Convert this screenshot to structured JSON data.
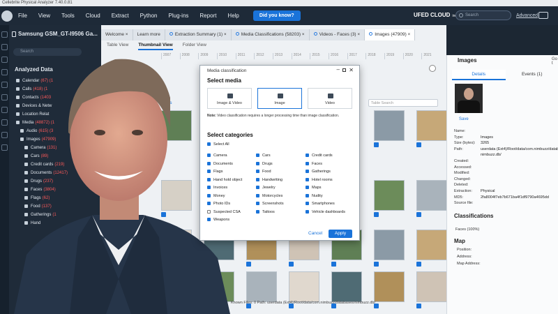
{
  "window": {
    "title": "Cellebrite Physical Analyzer 7.40.0.81"
  },
  "menubar": {
    "items": [
      "File",
      "View",
      "Tools",
      "Cloud",
      "Extract",
      "Python",
      "Plug-ins",
      "Report",
      "Help"
    ],
    "did_you_know": "Did you know?",
    "ufed_cloud": "UFED CLOUD",
    "ufed_cloud_sub": "included",
    "search_placeholder": "Search",
    "advanced": "Advanced"
  },
  "left_panel": {
    "device": "Samsung GSM_GT-I9506 Ga...",
    "search_placeholder": "Search",
    "analyzed_data": "Analyzed Data",
    "tree": [
      {
        "label": "Calendar",
        "count": "(67)",
        "extra": " (1"
      },
      {
        "label": "Calls",
        "count": "(418)",
        "extra": " (1"
      },
      {
        "label": "Contacts",
        "count": "(1403",
        "extra": ""
      },
      {
        "label": "Devices & Netw",
        "count": "",
        "extra": ""
      },
      {
        "label": "Location Relat",
        "count": "",
        "extra": ""
      },
      {
        "label": "Media",
        "count": "(48872)",
        "extra": " (1"
      },
      {
        "label": "Audio",
        "count": "(615)",
        "extra": " (3"
      },
      {
        "label": "Images",
        "count": "(47909)",
        "extra": ""
      },
      {
        "label": "Camera",
        "count": "(131)",
        "extra": ""
      },
      {
        "label": "Cars",
        "count": "(89)",
        "extra": ""
      },
      {
        "label": "Credit cards",
        "count": "(219)",
        "extra": ""
      },
      {
        "label": "Documents",
        "count": "(12417)",
        "extra": ""
      },
      {
        "label": "Drugs",
        "count": "(237)",
        "extra": ""
      },
      {
        "label": "Faces",
        "count": "(3804)",
        "extra": ""
      },
      {
        "label": "Flags",
        "count": "(62)",
        "extra": ""
      },
      {
        "label": "Food",
        "count": "(137)",
        "extra": ""
      },
      {
        "label": "Gatherings",
        "count": "(1",
        "extra": ""
      },
      {
        "label": "Hand",
        "count": "",
        "extra": ""
      }
    ]
  },
  "tabs": [
    {
      "label": "Welcome",
      "closable": true
    },
    {
      "label": "Learn more",
      "closable": false
    },
    {
      "label": "Extraction Summary (1)",
      "closable": true
    },
    {
      "label": "Media Classifications (58203)",
      "closable": true
    },
    {
      "label": "Videos - Faces (3)",
      "closable": true
    },
    {
      "label": "Images (47909)",
      "closable": true,
      "active": true
    }
  ],
  "sub_tabs": [
    "Table View",
    "Thumbnail View",
    "Folder View"
  ],
  "timeline": [
    "2007",
    "2008",
    "2009",
    "2010",
    "2011",
    "2012",
    "2013",
    "2014",
    "2015",
    "2016",
    "2017",
    "2018",
    "2019",
    "2020",
    "2021"
  ],
  "filters_label": "filters",
  "table_search_placeholder": "Table Search",
  "status": "Known Files: 0     Path: userdata (Ext4)/Root/data/com.nimbuzz/databases/nimbuzz.db/",
  "right_panel": {
    "title": "Images",
    "goto": "Go t",
    "tabs": [
      "Details",
      "Events (1)"
    ],
    "save": "Save",
    "fields": [
      {
        "k": "Name:",
        "v": ""
      },
      {
        "k": "Type:",
        "v": "Images"
      },
      {
        "k": "Size (bytes):",
        "v": "3265"
      },
      {
        "k": "Path:",
        "v": "userdata (Ext4)/Root/data/com.nimbuzz/databa"
      },
      {
        "k": "",
        "v": "nimbuzz.db/"
      },
      {
        "k": "Created:",
        "v": ""
      },
      {
        "k": "Accessed:",
        "v": ""
      },
      {
        "k": "Modified:",
        "v": ""
      },
      {
        "k": "Changed:",
        "v": ""
      },
      {
        "k": "Deleted:",
        "v": ""
      },
      {
        "k": "Extraction:",
        "v": "Physical"
      },
      {
        "k": "MD5:",
        "v": "2fa8004f7eb7b671ba4f1df9790a4695dd"
      },
      {
        "k": "Source file:",
        "v": ""
      }
    ],
    "classifications_title": "Classifications",
    "classifications_value": "Faces (100%)",
    "map_title": "Map",
    "map_fields": [
      "Position:",
      "Address:",
      "Map Address:"
    ]
  },
  "dialog": {
    "title": "Media classification",
    "select_media": "Select media",
    "media_options": [
      "Image & Video",
      "Image",
      "Video"
    ],
    "selected_media": "Image",
    "note_bold": "Note:",
    "note": " Video classification requires a longer processing time than image classification.",
    "select_categories": "Select categories",
    "select_all": "Select All",
    "categories": [
      {
        "label": "Camera",
        "checked": true
      },
      {
        "label": "Cars",
        "checked": true
      },
      {
        "label": "Credit cards",
        "checked": true
      },
      {
        "label": "Documents",
        "checked": true
      },
      {
        "label": "Drugs",
        "checked": true
      },
      {
        "label": "Faces",
        "checked": true
      },
      {
        "label": "Flags",
        "checked": true
      },
      {
        "label": "Food",
        "checked": true
      },
      {
        "label": "Gatherings",
        "checked": true
      },
      {
        "label": "Hand hold object",
        "checked": true
      },
      {
        "label": "Handwriting",
        "checked": true
      },
      {
        "label": "Hotel rooms",
        "checked": true
      },
      {
        "label": "Invoices",
        "checked": true
      },
      {
        "label": "Jewelry",
        "checked": true
      },
      {
        "label": "Maps",
        "checked": true
      },
      {
        "label": "Money",
        "checked": true
      },
      {
        "label": "Motorcycles",
        "checked": true
      },
      {
        "label": "Nudity",
        "checked": true
      },
      {
        "label": "Photo IDs",
        "checked": true
      },
      {
        "label": "Screenshots",
        "checked": true
      },
      {
        "label": "Smartphones",
        "checked": true
      },
      {
        "label": "Suspected CSA",
        "checked": false
      },
      {
        "label": "Tattoos",
        "checked": true
      },
      {
        "label": "Vehicle dashboards",
        "checked": true
      },
      {
        "label": "Weapons",
        "checked": true
      }
    ],
    "cancel": "Cancel",
    "apply": "Apply"
  },
  "colors": {
    "accent": "#1a73d9",
    "dark": "#1e2a38",
    "alert": "#ff5a5a"
  }
}
